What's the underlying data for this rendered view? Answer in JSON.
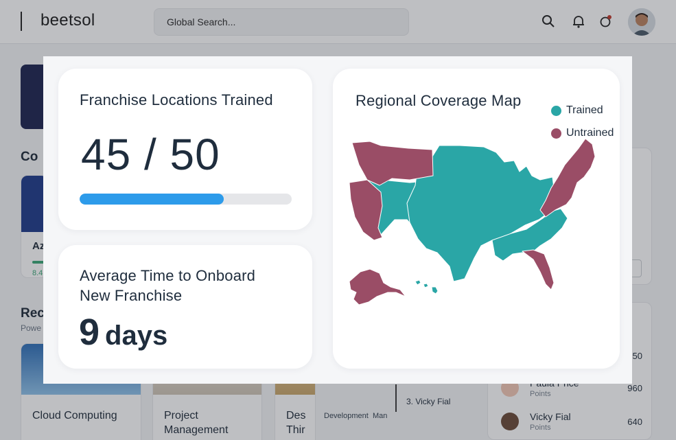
{
  "app": {
    "logo": "beetsol",
    "search_placeholder": "Global Search...",
    "background": {
      "courses_heading_fragment": "Co",
      "course_card_fragment": "Az",
      "course_card_stat_fragment": "8.4",
      "recommended_heading_fragment": "Rec",
      "recommended_sub_fragment": "Powe",
      "cards": [
        {
          "title": "Cloud Computing"
        },
        {
          "title": "Project Management"
        },
        {
          "title": "Des Thir"
        }
      ],
      "badge_labels": {
        "left": "Development",
        "right": "Man"
      },
      "ranking_item": "3. Vicky Fial",
      "leaderboard": [
        {
          "name": "",
          "points_label": "",
          "score": "50"
        },
        {
          "name": "Paula Price",
          "points_label": "Points",
          "score": "960"
        },
        {
          "name": "Vicky Fial",
          "points_label": "Points",
          "score": "640"
        }
      ]
    }
  },
  "modal": {
    "trained_card": {
      "title": "Franchise Locations Trained",
      "value": "45 / 50",
      "progress_fraction": 0.68
    },
    "onboard_card": {
      "title_line1": "Average Time to Onboard",
      "title_line2": "New Franchise",
      "value": "9",
      "unit": "days"
    },
    "map_card": {
      "title": "Regional Coverage Map",
      "legend": [
        {
          "label": "Trained",
          "color": "#2aa6a6"
        },
        {
          "label": "Untrained",
          "color": "#9a4d66"
        }
      ]
    }
  },
  "colors": {
    "trained": "#2aa6a6",
    "untrained": "#9a4d66",
    "progress": "#2d9bea"
  }
}
